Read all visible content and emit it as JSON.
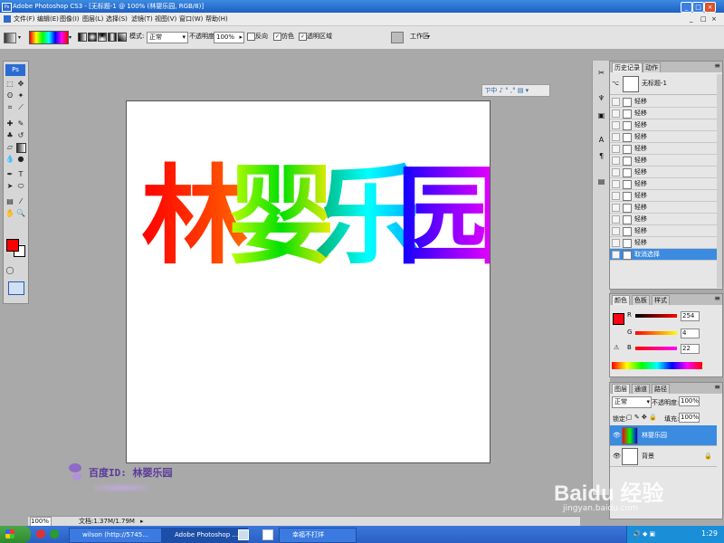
{
  "window": {
    "title": "Adobe Photoshop CS3 - [无标题-1 @ 100% (林婴乐园, RGB/8)]"
  },
  "menu": [
    "文件(F)",
    "编辑(E)",
    "图像(I)",
    "图层(L)",
    "选择(S)",
    "滤镜(T)",
    "视图(V)",
    "窗口(W)",
    "帮助(H)"
  ],
  "options": {
    "mode_label": "模式:",
    "mode_value": "正常",
    "opacity_label": "不透明度:",
    "opacity_value": "100%",
    "reverse": "反向",
    "dither": "仿色",
    "transparency": "透明区域",
    "workspace": "工作区"
  },
  "toolbox": {
    "logo": "Ps"
  },
  "canvas": {
    "text": [
      "林",
      "婴",
      "乐",
      "园"
    ]
  },
  "watermark": {
    "text": "百度ID: 林婴乐园"
  },
  "status": {
    "zoom": "100%",
    "doc": "文档:1.37M/1.79M"
  },
  "history": {
    "tabs": [
      "历史记录",
      "动作"
    ],
    "snapshot": "无标题-1",
    "items": [
      "轻移",
      "轻移",
      "轻移",
      "轻移",
      "轻移",
      "轻移",
      "轻移",
      "轻移",
      "轻移",
      "轻移",
      "轻移",
      "轻移",
      "轻移",
      "取消选择"
    ]
  },
  "color_panel": {
    "tabs": [
      "颜色",
      "色板",
      "样式"
    ],
    "r_label": "R",
    "r_value": "254",
    "g_label": "G",
    "g_value": "4",
    "b_label": "B",
    "b_value": "22",
    "fg_color": "#fe0416"
  },
  "layers_panel": {
    "tabs": [
      "图层",
      "通道",
      "路径"
    ],
    "blend": "正常",
    "opacity_label": "不透明度:",
    "opacity": "100%",
    "lock_label": "锁定:",
    "fill_label": "填充:",
    "fill": "100%",
    "layers": [
      {
        "name": "林婴乐园",
        "active": true
      },
      {
        "name": "背景",
        "active": false
      }
    ]
  },
  "taskbar": {
    "tasks": [
      "wilson (http://5745...",
      "Adobe Photoshop ...",
      "幸福不打烊"
    ],
    "clock": "1:29"
  },
  "baidu": {
    "brand": "Baidu 经验",
    "url": "jingyan.baidu.com"
  }
}
